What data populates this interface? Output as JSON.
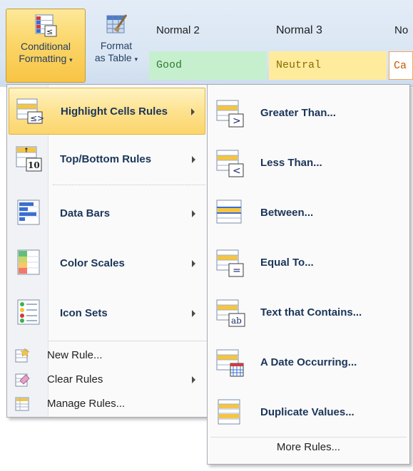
{
  "ribbon": {
    "conditional_formatting": {
      "line1": "Conditional",
      "line2": "Formatting",
      "icon": "conditional-formatting-icon"
    },
    "format_as_table": {
      "line1": "Format",
      "line2": "as Table",
      "icon": "format-as-table-icon"
    },
    "styles": [
      {
        "name": "Normal 2",
        "cell": "Good",
        "bg": "#c6efce",
        "fg": "#2e7d32"
      },
      {
        "name": "Normal 3",
        "cell": "Neutral",
        "bg": "#ffeb9c",
        "fg": "#8a6d00"
      },
      {
        "name": "No",
        "cell": "Ca",
        "bg": "#ffffff",
        "fg": "#c65a00"
      }
    ]
  },
  "menu": {
    "items": [
      {
        "label": "Highlight Cells Rules",
        "icon": "highlight-cells-rules-icon",
        "submenu": true,
        "highlighted": true
      },
      {
        "label": "Top/Bottom Rules",
        "icon": "top-bottom-rules-icon",
        "submenu": true
      },
      {
        "label": "Data Bars",
        "icon": "data-bars-icon",
        "submenu": true
      },
      {
        "label": "Color Scales",
        "icon": "color-scales-icon",
        "submenu": true
      },
      {
        "label": "Icon Sets",
        "icon": "icon-sets-icon",
        "submenu": true
      }
    ],
    "commands": [
      {
        "label": "New Rule...",
        "icon": "new-rule-icon",
        "submenu": false
      },
      {
        "label": "Clear Rules",
        "icon": "clear-rules-icon",
        "submenu": true
      },
      {
        "label": "Manage Rules...",
        "icon": "manage-rules-icon",
        "submenu": false
      }
    ]
  },
  "submenu": {
    "items": [
      {
        "label": "Greater Than...",
        "icon": "greater-than-icon"
      },
      {
        "label": "Less Than...",
        "icon": "less-than-icon"
      },
      {
        "label": "Between...",
        "icon": "between-icon"
      },
      {
        "label": "Equal To...",
        "icon": "equal-to-icon"
      },
      {
        "label": "Text that Contains...",
        "icon": "text-contains-icon"
      },
      {
        "label": "A Date Occurring...",
        "icon": "date-occurring-icon"
      },
      {
        "label": "Duplicate Values...",
        "icon": "duplicate-values-icon"
      }
    ],
    "more_rules": "More Rules..."
  },
  "colors": {
    "hover_gold": "#fcd56c",
    "menu_text": "#1b3559",
    "ribbon_bg": "#dbe6f4"
  }
}
